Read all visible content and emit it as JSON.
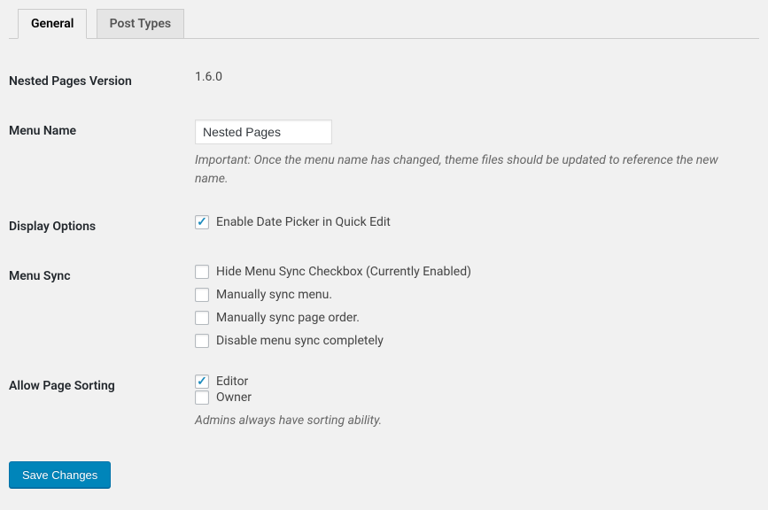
{
  "tabs": {
    "general": "General",
    "post_types": "Post Types"
  },
  "rows": {
    "version": {
      "label": "Nested Pages Version",
      "value": "1.6.0"
    },
    "menu_name": {
      "label": "Menu Name",
      "value": "Nested Pages",
      "description": "Important: Once the menu name has changed, theme files should be updated to reference the new name."
    },
    "display_options": {
      "label": "Display Options",
      "enable_datepicker": "Enable Date Picker in Quick Edit"
    },
    "menu_sync": {
      "label": "Menu Sync",
      "hide_checkbox": "Hide Menu Sync Checkbox (Currently Enabled)",
      "manual_sync_menu": "Manually sync menu.",
      "manual_sync_page_order": "Manually sync page order.",
      "disable_completely": "Disable menu sync completely"
    },
    "allow_sorting": {
      "label": "Allow Page Sorting",
      "editor": "Editor",
      "owner": "Owner",
      "description": "Admins always have sorting ability."
    }
  },
  "buttons": {
    "save": "Save Changes"
  }
}
